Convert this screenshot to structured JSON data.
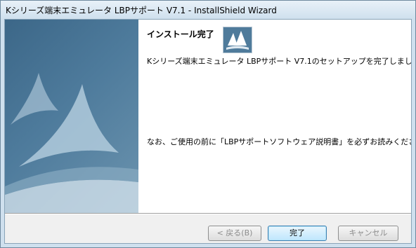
{
  "window": {
    "title": "Kシリーズ端末エミュレータ LBPサポート V7.1 - InstallShield Wizard"
  },
  "content": {
    "heading": "インストール完了",
    "message_complete": "Kシリーズ端末エミュレータ LBPサポート V7.1のセットアップを完了しました。",
    "message_note": "なお、ご使用の前に「LBPサポートソフトウェア説明書」を必ずお読みください。"
  },
  "buttons": {
    "back": "< 戻る(B)",
    "finish": "完了",
    "cancel": "キャンセル"
  },
  "icons": {
    "banner": "sail-tent-graphic",
    "logo": "installshield-sail-logo"
  }
}
